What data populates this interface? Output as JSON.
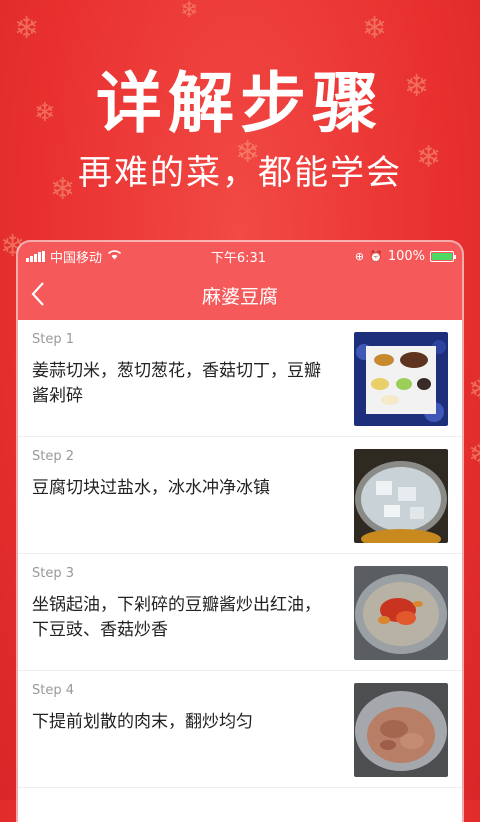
{
  "promo": {
    "title": "详解步骤",
    "subtitle": "再难的菜，都能学会"
  },
  "status_bar": {
    "carrier": "中国移动",
    "time": "下午6:31",
    "battery": "100%"
  },
  "nav": {
    "back_icon": "chevron-left-icon",
    "title": "麻婆豆腐"
  },
  "steps": [
    {
      "label": "Step 1",
      "text": "姜蒜切米，葱切葱花，香菇切丁，豆瓣酱剁碎"
    },
    {
      "label": "Step 2",
      "text": "豆腐切块过盐水，冰水冲净冰镇"
    },
    {
      "label": "Step 3",
      "text": " 坐锅起油，下剁碎的豆瓣酱炒出红油，下豆豉、香菇炒香"
    },
    {
      "label": "Step 4",
      "text": " 下提前划散的肉末，翻炒均匀"
    }
  ],
  "colors": {
    "background": "#e8302f",
    "header": "#f5595a",
    "snowflake": "#f7a07f"
  }
}
